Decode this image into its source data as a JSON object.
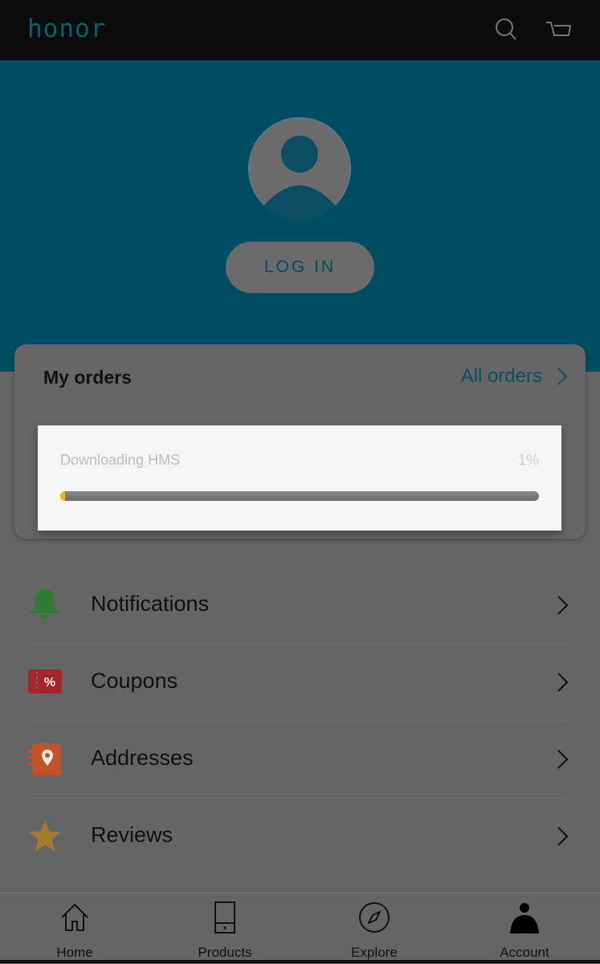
{
  "header": {
    "logo": "honor",
    "icons": [
      "search-icon",
      "cart-icon"
    ]
  },
  "profile": {
    "avatar_icon": "user-avatar-icon",
    "login_label": "LOG IN"
  },
  "orders": {
    "title": "My orders",
    "all_orders_label": "All orders"
  },
  "download_dialog": {
    "label": "Downloading HMS",
    "percent_text": "1%",
    "progress_fraction": 0.01
  },
  "menu": {
    "items": [
      {
        "label": "Notifications",
        "icon": "bell-icon"
      },
      {
        "label": "Coupons",
        "icon": "coupon-icon"
      },
      {
        "label": "Addresses",
        "icon": "address-book-icon"
      },
      {
        "label": "Reviews",
        "icon": "star-icon"
      }
    ]
  },
  "bottom_nav": {
    "items": [
      {
        "label": "Home",
        "icon": "home-icon"
      },
      {
        "label": "Products",
        "icon": "phone-icon"
      },
      {
        "label": "Explore",
        "icon": "compass-icon"
      },
      {
        "label": "Account",
        "icon": "account-icon",
        "active": true
      }
    ]
  },
  "colors": {
    "brand": "#0e5e72",
    "hero": "#004c63",
    "progress": "#f5b800",
    "bell": "#2e7d32",
    "coupon": "#a3262a",
    "address": "#c0532a",
    "star": "#a57a2a"
  }
}
